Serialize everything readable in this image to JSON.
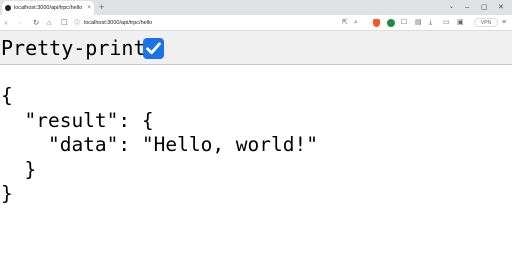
{
  "browser": {
    "tab": {
      "title": "localhost:3000/api/trpc/hello",
      "close_icon": "×"
    },
    "new_tab_label": "+",
    "window_controls": {
      "dropdown": "⌄",
      "minimize": "–",
      "maximize": "▢",
      "close": "✕"
    },
    "address_bar": {
      "url": "localhost:3000/api/trpc/hello"
    },
    "vpn_label": "VPN"
  },
  "page": {
    "pretty_print": {
      "label": "Pretty-print",
      "checked": true,
      "checkbox_color": "#1a73e8"
    },
    "json": {
      "line1": "{",
      "line2": "  \"result\": {",
      "line3": "    \"data\": \"Hello, world!\"",
      "line4": "  }",
      "line5": "}"
    }
  }
}
